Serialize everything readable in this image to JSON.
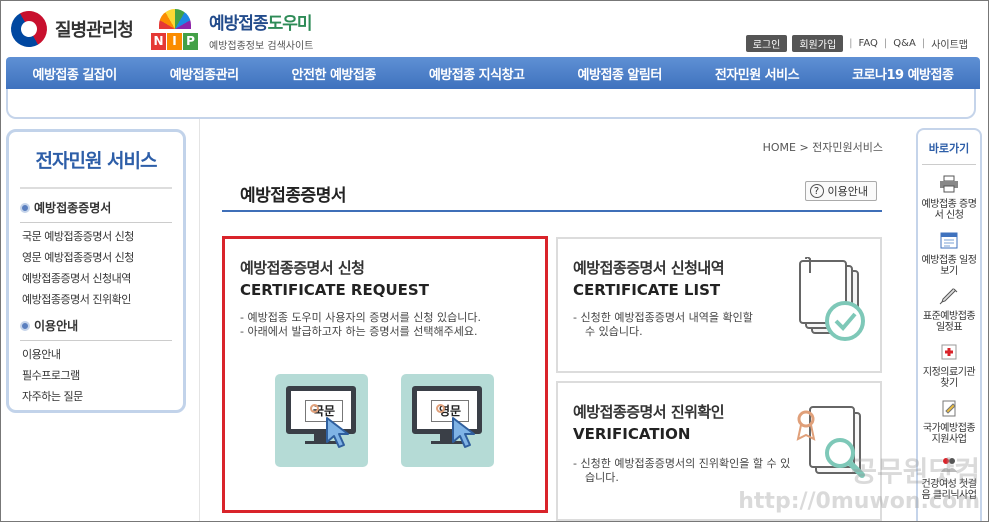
{
  "header": {
    "kdca_name": "질병관리청",
    "nip_letters": [
      "N",
      "I",
      "P"
    ],
    "nip_title_a": "예방접종",
    "nip_title_b": "도우미",
    "nip_subtitle": "예방접종정보 검색사이트",
    "util": {
      "login": "로그인",
      "join": "회원가입",
      "faq": "FAQ",
      "qna": "Q&A",
      "sitemap": "사이트맵",
      "separator": "|"
    }
  },
  "gnb": [
    "예방접종 길잡이",
    "예방접종관리",
    "안전한 예방접종",
    "예방접종 지식창고",
    "예방접종 알림터",
    "전자민원 서비스",
    "코로나19 예방접종"
  ],
  "lnb": {
    "title": "전자민원 서비스",
    "sections": [
      {
        "head": "예방접종증명서",
        "items": [
          "국문 예방접종증명서 신청",
          "영문 예방접종증명서 신청",
          "예방접종증명서 신청내역",
          "예방접종증명서 진위확인"
        ]
      },
      {
        "head": "이용안내",
        "items": [
          "이용안내",
          "필수프로그램",
          "자주하는 질문"
        ]
      }
    ]
  },
  "breadcrumb": {
    "home": "HOME",
    "sep": ">",
    "current": "전자민원서비스"
  },
  "page_title": "예방접종증명서",
  "guide_button": {
    "q": "?",
    "label": "이용안내"
  },
  "cards": {
    "request": {
      "title": "예방접종증명서 신청",
      "subtitle": "CERTIFICATE REQUEST",
      "desc": [
        "- 예방접종 도우미 사용자의 증명서를 신청 있습니다.",
        "- 아래에서 발급하고자 하는 증명서를 선택해주세요."
      ],
      "korean_label": "국문",
      "english_label": "영문"
    },
    "list": {
      "title": "예방접종증명서 신청내역",
      "subtitle": "CERTIFICATE LIST",
      "desc": [
        "- 신청한 예방접종증명서 내역을 확인할 수 있습니다."
      ]
    },
    "verification": {
      "title": "예방접종증명서 진위확인",
      "subtitle": "VERIFICATION",
      "desc": [
        "- 신청한 예방접종증명서의 진위확인을 할 수 있습니다."
      ]
    }
  },
  "quick": {
    "title": "바로가기",
    "items": [
      "예방접종 증명서 신청",
      "예방접종 일정보기",
      "표준예방접종 일정표",
      "지정의료기관 찾기",
      "국가예방접종 지원사업",
      "건강여성 첫걸음 클리닉사업"
    ]
  },
  "watermark": {
    "line1": "공무원닷컴",
    "line2": "http://0muwon.com"
  },
  "colors": {
    "accent": "#3f72be",
    "highlight": "#d9232a",
    "card_button": "#b5dbd6"
  }
}
